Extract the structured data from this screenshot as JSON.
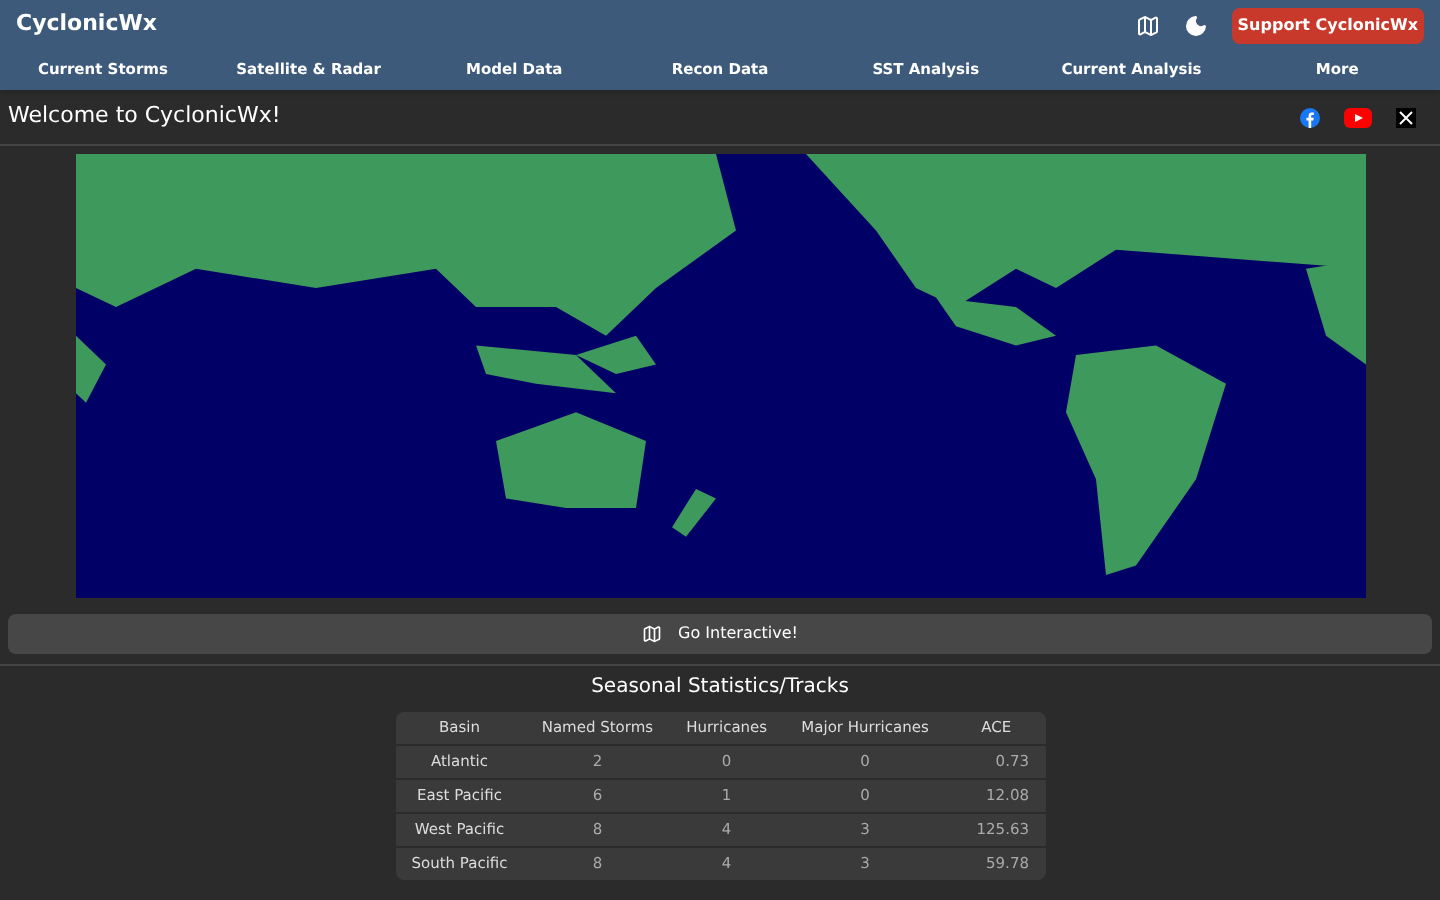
{
  "header": {
    "title": "CyclonicWx",
    "support_button": "Support CyclonicWx"
  },
  "nav": [
    "Current Storms",
    "Satellite & Radar",
    "Model Data",
    "Recon Data",
    "SST Analysis",
    "Current Analysis",
    "More"
  ],
  "welcome": "Welcome to CyclonicWx!",
  "interactive_button": "Go Interactive!",
  "stats": {
    "title": "Seasonal Statistics/Tracks",
    "columns": [
      "Basin",
      "Named Storms",
      "Hurricanes",
      "Major Hurricanes",
      "ACE"
    ],
    "rows": [
      [
        "Atlantic",
        "2",
        "0",
        "0",
        "0.73"
      ],
      [
        "East Pacific",
        "6",
        "1",
        "0",
        "12.08"
      ],
      [
        "West Pacific",
        "8",
        "4",
        "3",
        "125.63"
      ],
      [
        "South Pacific",
        "8",
        "4",
        "3",
        "59.78"
      ]
    ]
  }
}
